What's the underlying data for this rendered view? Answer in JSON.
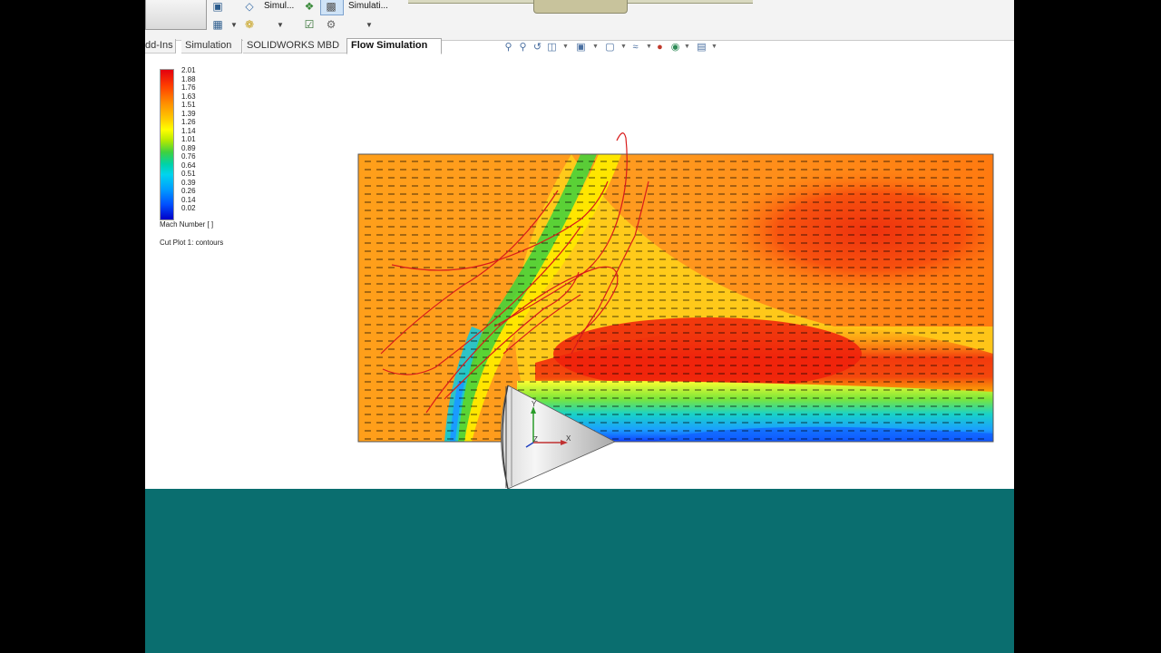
{
  "ribbon": {
    "simulation_label_1": "Simul...",
    "simulation_label_2": "Simulati..."
  },
  "tabs": [
    {
      "label": "dd-Ins"
    },
    {
      "label": "Simulation"
    },
    {
      "label": "SOLIDWORKS MBD"
    },
    {
      "label": "Flow Simulation"
    }
  ],
  "view_toolbar": {
    "icons": [
      "zoom-to-fit-icon",
      "zoom-to-area-icon",
      "previous-view-icon",
      "section-view-icon",
      "view-orientation-icon",
      "display-style-icon",
      "hide-show-icon",
      "edit-appearance-icon",
      "apply-scene-icon",
      "view-settings-icon"
    ]
  },
  "legend": {
    "ticks": [
      "2.01",
      "1.88",
      "1.76",
      "1.63",
      "1.51",
      "1.39",
      "1.26",
      "1.14",
      "1.01",
      "0.89",
      "0.76",
      "0.64",
      "0.51",
      "0.39",
      "0.26",
      "0.14",
      "0.02"
    ],
    "title": "Mach Number [ ]",
    "plot_label": "Cut Plot 1: contours"
  },
  "triad": {
    "x_label": "X",
    "y_label": "Y",
    "z_label": "Z"
  },
  "colors": {
    "footer": "#0a6e6f",
    "annotation": "#d81b1b"
  }
}
